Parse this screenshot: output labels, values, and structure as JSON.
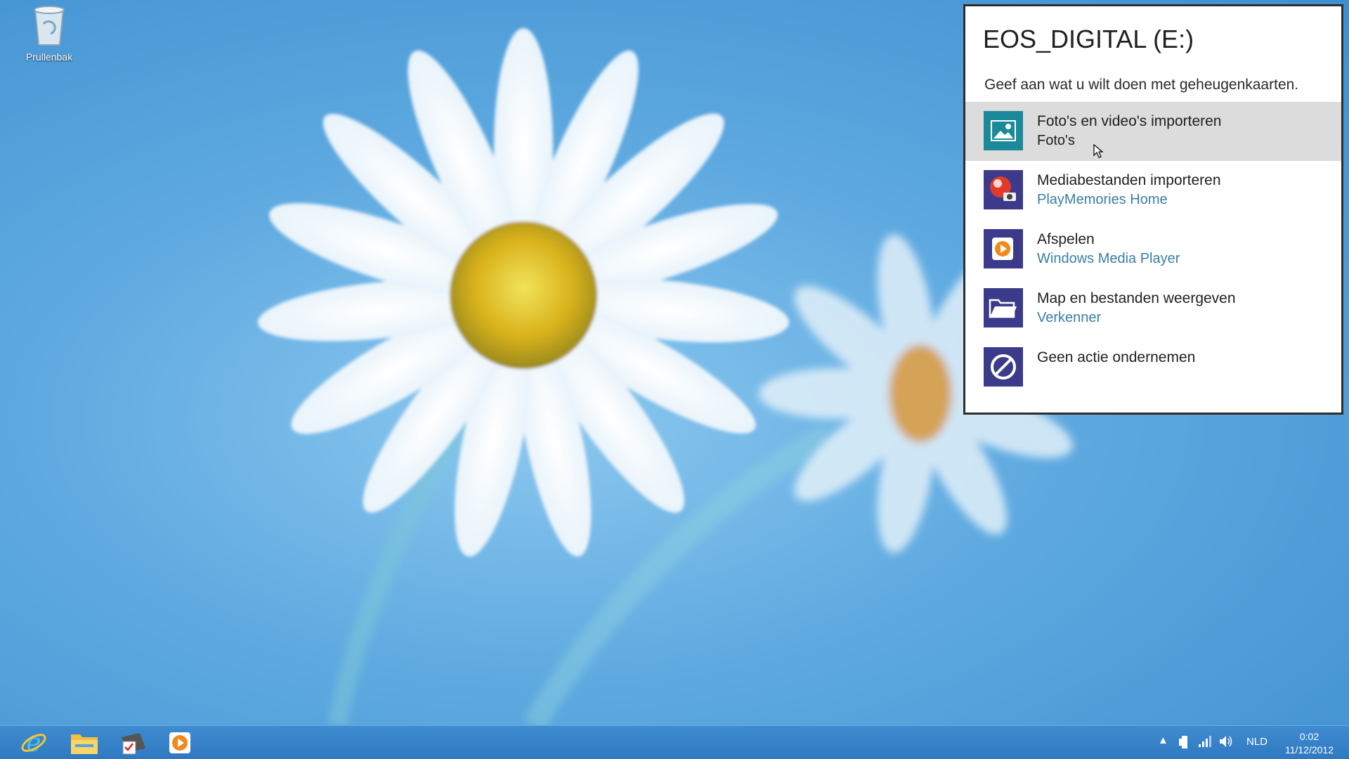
{
  "desktop": {
    "recycle_bin_label": "Prullenbak",
    "wallpaper": "daisy-flower-blue-background"
  },
  "autoplay": {
    "title": "EOS_DIGITAL (E:)",
    "subtitle": "Geef aan wat u wilt doen met geheugenkaarten.",
    "options": [
      {
        "label": "Foto's en video's importeren",
        "app": "Foto's",
        "icon": "photos-icon",
        "selected": true
      },
      {
        "label": "Mediabestanden importeren",
        "app": "PlayMemories Home",
        "icon": "playmemories-icon",
        "selected": false
      },
      {
        "label": "Afspelen",
        "app": "Windows Media Player",
        "icon": "media-player-icon",
        "selected": false
      },
      {
        "label": "Map en bestanden weergeven",
        "app": "Verkenner",
        "icon": "folder-icon",
        "selected": false
      },
      {
        "label": "Geen actie ondernemen",
        "app": "",
        "icon": "no-action-icon",
        "selected": false
      }
    ]
  },
  "taskbar": {
    "pinned": [
      "internet-explorer-icon",
      "file-explorer-icon",
      "windows-journal-icon",
      "media-player-icon"
    ],
    "tray": {
      "language": "NLD",
      "time": "0:02",
      "date": "11/12/2012"
    }
  },
  "colors": {
    "accent": "#4a3a9a",
    "photos_tile": "#1a8a9a",
    "taskbar": "#3583c8"
  }
}
